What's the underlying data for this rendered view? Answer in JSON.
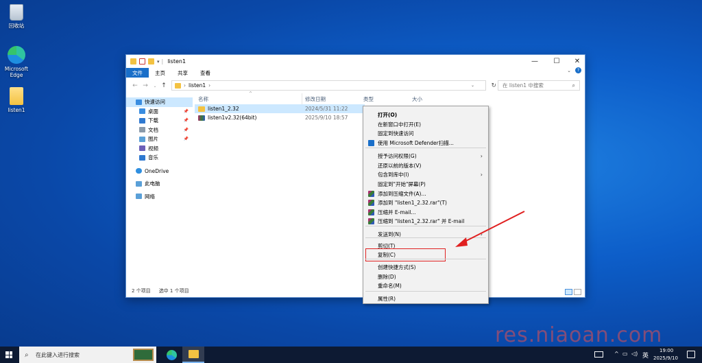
{
  "desktop": {
    "icons": [
      {
        "label": "回收站"
      },
      {
        "label": "Microsoft Edge"
      },
      {
        "label": "listen1"
      }
    ],
    "watermark": "res.niaoan.com"
  },
  "window": {
    "title": "listen1",
    "controls": {
      "minimize": "—",
      "maximize": "☐",
      "close": "✕"
    },
    "ribbon_tabs": [
      "文件",
      "主页",
      "共享",
      "查看"
    ],
    "address": "listen1",
    "address_chevron": "›",
    "search_placeholder": "在 listen1 中搜索",
    "sidebar": [
      {
        "label": "快速访问",
        "color": "#3a8de0",
        "pinned": false
      },
      {
        "label": "桌面",
        "color": "#3a8de0",
        "pinned": true
      },
      {
        "label": "下载",
        "color": "#2f79d0",
        "pinned": true
      },
      {
        "label": "文档",
        "color": "#8a9aaa",
        "pinned": true
      },
      {
        "label": "图片",
        "color": "#5aa0d8",
        "pinned": true
      },
      {
        "label": "视频",
        "color": "#6c5fb8",
        "pinned": false
      },
      {
        "label": "音乐",
        "color": "#2f79d0",
        "pinned": false
      },
      {
        "label": "OneDrive",
        "color": "#2f8fe0",
        "pinned": false
      },
      {
        "label": "此电脑",
        "color": "#5aa0d8",
        "pinned": false
      },
      {
        "label": "网络",
        "color": "#5aa0d8",
        "pinned": false
      }
    ],
    "columns": [
      "名称",
      "修改日期",
      "类型",
      "大小"
    ],
    "files": [
      {
        "name": "listen1_2.32",
        "date": "2024/5/31 11:22",
        "selected": true
      },
      {
        "name": "listen1v2.32(64bit)",
        "date": "2025/9/10 18:57",
        "selected": false
      }
    ],
    "status": {
      "count": "2 个项目",
      "selected": "选中 1 个项目"
    }
  },
  "context_menu": {
    "items": [
      {
        "label": "打开(O)",
        "bold": true
      },
      {
        "label": "在新窗口中打开(E)"
      },
      {
        "label": "固定到快速访问"
      },
      {
        "label": "使用 Microsoft Defender扫描...",
        "icon": "defender"
      },
      {
        "label": "授予访问权限(G)",
        "submenu": true
      },
      {
        "label": "还原以前的版本(V)"
      },
      {
        "label": "包含到库中(I)",
        "submenu": true
      },
      {
        "label": "固定到\"开始\"屏幕(P)"
      },
      {
        "label": "添加到压缩文件(A)...",
        "icon": "rar"
      },
      {
        "label": "添加到 \"listen1_2.32.rar\"(T)",
        "icon": "rar"
      },
      {
        "label": "压缩并 E-mail...",
        "icon": "rar"
      },
      {
        "label": "压缩到 \"listen1_2.32.rar\" 并 E-mail",
        "icon": "rar"
      },
      {
        "label": "发送到(N)",
        "submenu": true
      },
      {
        "label": "剪切(T)"
      },
      {
        "label": "复制(C)",
        "highlighted": true
      },
      {
        "label": "创建快捷方式(S)"
      },
      {
        "label": "删除(D)"
      },
      {
        "label": "重命名(M)"
      },
      {
        "label": "属性(R)"
      }
    ],
    "highlight_color": "#e02020"
  },
  "taskbar": {
    "search_placeholder": "在此键入进行搜索",
    "time": "19:00",
    "date": "2025/9/10",
    "ime": "英"
  }
}
